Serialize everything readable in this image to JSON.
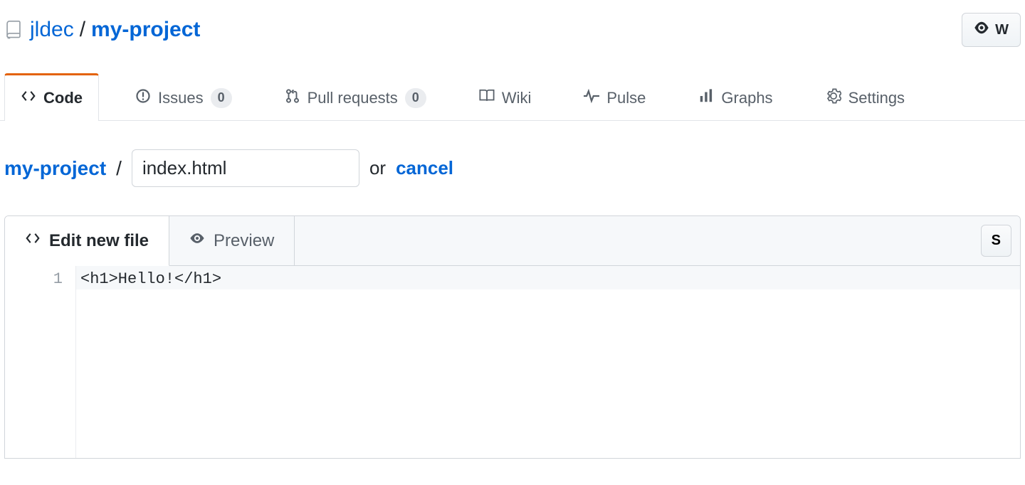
{
  "header": {
    "owner": "jldec",
    "repo": "my-project",
    "watch_label": "W"
  },
  "nav": {
    "code": "Code",
    "issues": "Issues",
    "issues_count": "0",
    "pulls": "Pull requests",
    "pulls_count": "0",
    "wiki": "Wiki",
    "pulse": "Pulse",
    "graphs": "Graphs",
    "settings": "Settings"
  },
  "filepath": {
    "root": "my-project",
    "filename_value": "index.html",
    "or_text": "or",
    "cancel": "cancel"
  },
  "editor": {
    "edit_tab": "Edit new file",
    "preview_tab": "Preview",
    "right_button": "S",
    "lines": {
      "n1": "1",
      "l1": "<h1>Hello!</h1>"
    }
  }
}
